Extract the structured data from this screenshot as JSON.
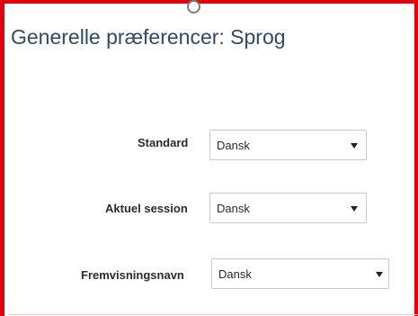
{
  "page": {
    "title": "Generelle præferencer: Sprog"
  },
  "accent_color": "#e8000b",
  "language_settings": [
    {
      "label": "Standard",
      "value": "Dansk",
      "icon": "chevron-down-icon"
    },
    {
      "label": "Aktuel session",
      "value": "Dansk",
      "icon": "chevron-down-icon"
    },
    {
      "label": "Fremvisningsnavn",
      "value": "Dansk",
      "icon": "chevron-down-icon"
    }
  ]
}
